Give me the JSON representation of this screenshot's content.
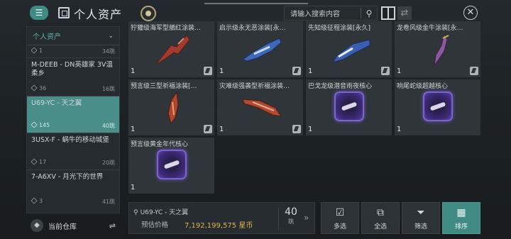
{
  "header": {
    "title": "个人资产",
    "search_placeholder": "请输入搜索内容",
    "menu_icon": "menu-icon",
    "close_icon": "close-icon"
  },
  "sidebar": {
    "dropdown_label": "个人资产",
    "locations": [
      {
        "name": "",
        "count": "1",
        "jumps": "34跳",
        "selected": false
      },
      {
        "name": "M-DEEB - DN英雄家 3V温柔乡",
        "count": "36",
        "jumps": "16跳",
        "selected": false
      },
      {
        "name": "U69-YC - 天之翼",
        "count": "145",
        "jumps": "40跳",
        "selected": true
      },
      {
        "name": "3USX-F - 蜗牛的移动城堡",
        "count": "17",
        "jumps": "20跳",
        "selected": false
      },
      {
        "name": "7-A6XV - 月光下的世界",
        "count": "3",
        "jumps": "41跳",
        "selected": false
      }
    ],
    "warehouse_label": "当前仓库"
  },
  "items": [
    {
      "name": "狞獾级海军型舾红涂装…",
      "qty": "1",
      "kind": "ship",
      "color": "#a23a2e"
    },
    {
      "name": "启示级永无恶涂装[永…",
      "qty": "1",
      "kind": "ship",
      "color": "#3e68b8"
    },
    {
      "name": "先知级征程涂装[永久]",
      "qty": "1",
      "kind": "ship",
      "color": "#3a5fb0"
    },
    {
      "name": "龙卷风级金牛涂装[永…",
      "qty": "1",
      "kind": "ship",
      "color": "#8b5a9e"
    },
    {
      "name": "预言级三型祈福涂装[…",
      "qty": "1",
      "kind": "ship",
      "color": "#b0452e"
    },
    {
      "name": "灾难级强袭型祈福涂装…",
      "qty": "1",
      "kind": "ship",
      "color": "#b24a32"
    },
    {
      "name": "巴戈龙级潜音雨夜核心",
      "qty": "1",
      "kind": "core",
      "color": "#6b52c2"
    },
    {
      "name": "响尾蛇级超越核心",
      "qty": "1",
      "kind": "core",
      "color": "#6b52c2"
    },
    {
      "name": "预言级黄金年代核心",
      "qty": "1",
      "kind": "core",
      "color": "#6b52c2"
    }
  ],
  "bottom": {
    "location": "U69-YC - 天之翼",
    "price_label": "预估价格",
    "price_value": "7,192,199,575 星币",
    "jumps_num": "40",
    "jumps_unit": "跳",
    "actions": [
      {
        "label": "多选",
        "icon": "checkbox-icon"
      },
      {
        "label": "全选",
        "icon": "select-all-icon"
      },
      {
        "label": "筛选",
        "icon": "filter-icon"
      },
      {
        "label": "排序",
        "icon": "sort-icon"
      }
    ]
  },
  "colors": {
    "accent": "#3f8a83",
    "price": "#e0b64a",
    "sidebar_accent": "#5fb5a8"
  }
}
